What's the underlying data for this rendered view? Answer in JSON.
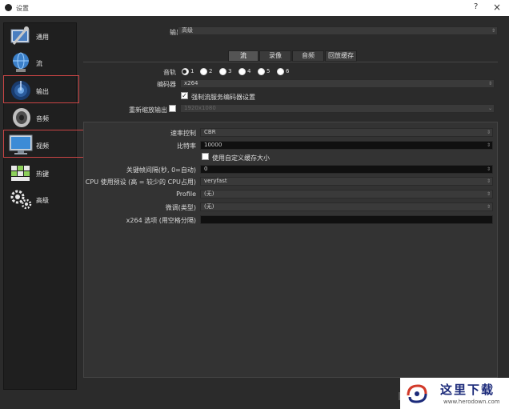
{
  "window": {
    "title": "设置",
    "help_glyph": "?",
    "close_glyph": "×"
  },
  "sidebar": {
    "items": [
      {
        "label": "通用",
        "icon": "wrench-screen-icon"
      },
      {
        "label": "流",
        "icon": "globe-network-icon"
      },
      {
        "label": "输出",
        "icon": "broadcast-dish-icon"
      },
      {
        "label": "音频",
        "icon": "speaker-icon"
      },
      {
        "label": "视频",
        "icon": "monitor-icon"
      },
      {
        "label": "热键",
        "icon": "keyboard-icon"
      },
      {
        "label": "高级",
        "icon": "gears-icon"
      }
    ]
  },
  "output": {
    "mode_label": "输出模式",
    "mode_value": "高级",
    "tabs": [
      "流",
      "录像",
      "音频",
      "回放缓存"
    ],
    "active_tab": "流",
    "track_label": "音轨",
    "tracks": [
      "1",
      "2",
      "3",
      "4",
      "5",
      "6"
    ],
    "selected_track": "1",
    "encoder_label": "编码器",
    "encoder_value": "x264",
    "enforce_label": "强制流服务编码器设置",
    "enforce_checked": true,
    "rescale_label": "重新缩放输出",
    "rescale_checked": false,
    "rescale_value": "1920x1080"
  },
  "encoder_settings": {
    "rate_control_label": "速率控制",
    "rate_control_value": "CBR",
    "bitrate_label": "比特率",
    "bitrate_value": "10000",
    "custom_buffer_label": "使用自定义缓存大小",
    "custom_buffer_checked": false,
    "keyframe_label": "关键帧间隔(秒, 0=自动)",
    "keyframe_value": "0",
    "cpu_preset_label": "CPU 使用预设 (高 = 较少的 CPU占用)",
    "cpu_preset_value": "veryfast",
    "profile_label": "Profile",
    "profile_value": "(无)",
    "tune_label": "微调(类型)",
    "tune_value": "(无)",
    "x264_opts_label": "x264 选项 (用空格分隔)",
    "x264_opts_value": ""
  },
  "watermark": {
    "cn": "这里下载",
    "url": "www.herodown.com"
  }
}
